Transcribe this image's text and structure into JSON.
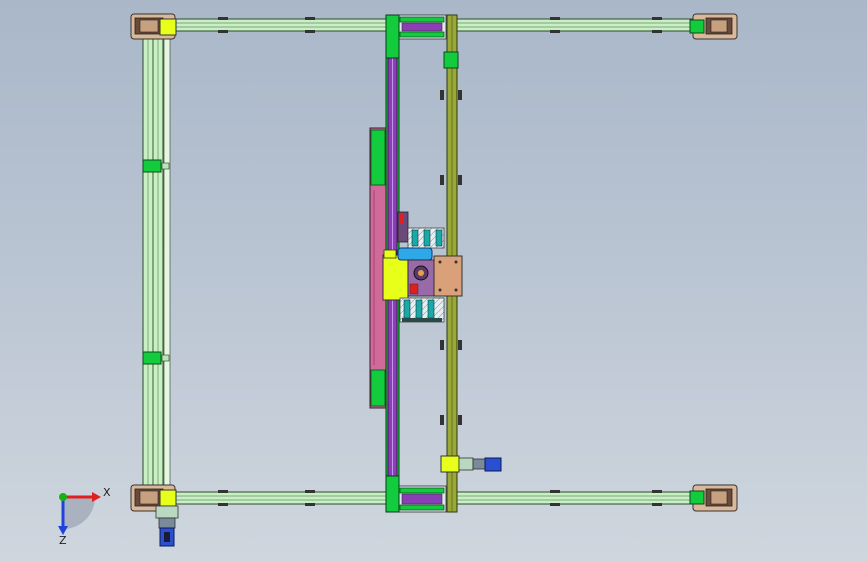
{
  "colors": {
    "background_top": "#a9b7c9",
    "background_bottom": "#cfd6de",
    "rail_fill": "#c8f0c2",
    "rail_edge": "#2a4a2a",
    "bracket_yellow": "#e8ff1a",
    "bracket_green": "#12cc3e",
    "beam_purple": "#8a3fb5",
    "beam_olive": "#7a8a1c",
    "panel_pink": "#cf6a9a",
    "plate_tan": "#d9a07a",
    "motor_blue": "#2a4fd0",
    "axis_x": "#e02020",
    "axis_y": "#18b018",
    "axis_z": "#2040e0"
  },
  "triad": {
    "x_label": "X",
    "z_label": "Z"
  }
}
